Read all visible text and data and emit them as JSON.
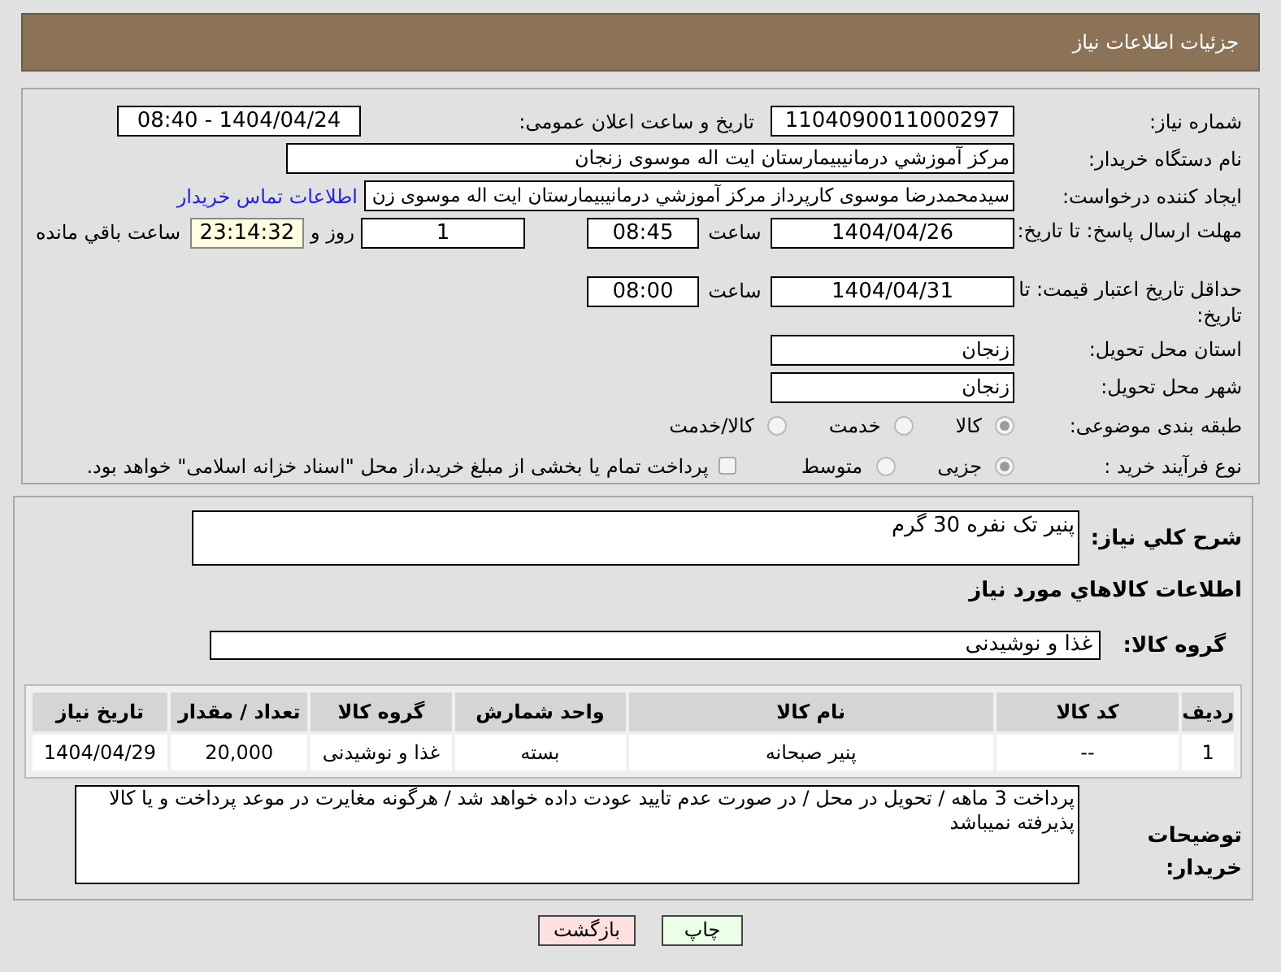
{
  "header": {
    "title": "جزئیات اطلاعات نیاز"
  },
  "need_number": {
    "label": "شماره نیاز:",
    "value": "1104090011000297"
  },
  "announce": {
    "label": "تاریخ و ساعت اعلان عمومی:",
    "value": "1404/04/24 - 08:40"
  },
  "buyer": {
    "label": "نام دستگاه خریدار:",
    "value": "مرکز آموزشي درمانيبيمارستان ايت اله موسوی زنجان"
  },
  "creator": {
    "label": "ایجاد کننده درخواست:",
    "value": "سیدمحمدرضا موسوی کارپرداز مرکز آموزشي درمانيبيمارستان ايت اله موسوی زن",
    "link": "اطلاعات تماس خریدار"
  },
  "deadline": {
    "label": "مهلت ارسال پاسخ: تا تاریخ:",
    "date": "1404/04/26",
    "time_label": "ساعت",
    "time": "08:45",
    "days": "1",
    "days_label": "روز و",
    "remaining": "23:14:32",
    "remaining_label": "ساعت باقي مانده"
  },
  "validity": {
    "label": "حداقل تاریخ اعتبار قیمت: تا تاریخ:",
    "date": "1404/04/31",
    "time_label": "ساعت",
    "time": "08:00"
  },
  "province": {
    "label": "استان محل تحویل:",
    "value": "زنجان"
  },
  "city": {
    "label": "شهر محل تحویل:",
    "value": "زنجان"
  },
  "category": {
    "label": "طبقه بندی موضوعی:",
    "options": [
      {
        "label": "کالا",
        "selected": true
      },
      {
        "label": "خدمت",
        "selected": false
      },
      {
        "label": "کالا/خدمت",
        "selected": false
      }
    ]
  },
  "process": {
    "label": "نوع فرآیند خرید :",
    "options": [
      {
        "label": "جزیی",
        "selected": true
      },
      {
        "label": "متوسط",
        "selected": false
      }
    ],
    "payment": {
      "checked": false,
      "text": "پرداخت تمام یا بخشی از مبلغ خرید،از محل \"اسناد خزانه اسلامی\" خواهد بود."
    }
  },
  "description": {
    "label": "شرح کلي نیاز:",
    "value": "پنیر تک نفره 30 گرم"
  },
  "goods_heading": "اطلاعات کالاهاي مورد نیاز",
  "goods_group": {
    "label": "گروه کالا:",
    "value": "غذا و نوشیدنی"
  },
  "table": {
    "columns": [
      "ردیف",
      "کد کالا",
      "نام کالا",
      "واحد شمارش",
      "گروه کالا",
      "تعداد / مقدار",
      "تاریخ نیاز"
    ],
    "rows": [
      [
        "1",
        "--",
        "پنیر صبحانه",
        "بسته",
        "غذا و نوشیدنی",
        "20,000",
        "1404/04/29"
      ]
    ]
  },
  "notes": {
    "label": "توضیحات خریدار:",
    "value": "پرداخت 3 ماهه / تحویل در محل / در صورت عدم تایید عودت داده خواهد شد / هرگونه مغایرت در موعد پرداخت و یا کالا پذیرفته نمیباشد"
  },
  "buttons": [
    {
      "label": "چاپ",
      "kind": "print"
    },
    {
      "label": "بازگشت",
      "kind": "back"
    }
  ]
}
